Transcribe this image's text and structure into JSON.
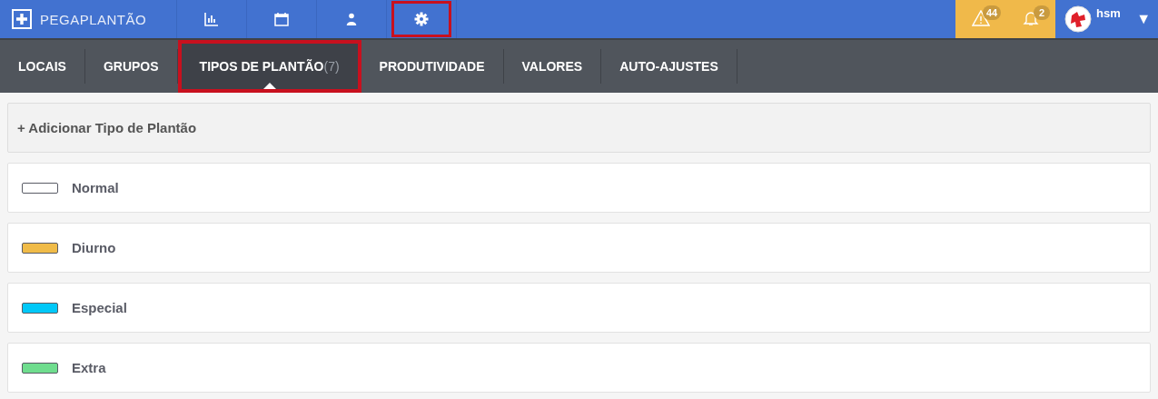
{
  "brand": {
    "name": "PEGAPLANTÃO"
  },
  "nav": [
    {
      "kind": "chart",
      "highlighted": false
    },
    {
      "kind": "calendar",
      "highlighted": false
    },
    {
      "kind": "user",
      "highlighted": false
    },
    {
      "kind": "settings",
      "highlighted": true
    }
  ],
  "alerts": [
    {
      "kind": "warning",
      "count": "44"
    },
    {
      "kind": "bell",
      "count": "2"
    }
  ],
  "user": {
    "name": "hsm",
    "caret": "▼"
  },
  "tabs": [
    {
      "label": "LOCAIS",
      "selected": false,
      "highlighted": false
    },
    {
      "label": "GRUPOS",
      "selected": false,
      "highlighted": false
    },
    {
      "label": "TIPOS DE PLANTÃO",
      "count": "(7)",
      "selected": true,
      "highlighted": true
    },
    {
      "label": "PRODUTIVIDADE",
      "selected": false,
      "highlighted": false
    },
    {
      "label": "VALORES",
      "selected": false,
      "highlighted": false
    },
    {
      "label": "AUTO-AJUSTES",
      "selected": false,
      "highlighted": false
    }
  ],
  "add_button": "+ Adicionar Tipo de Plantão",
  "shift_types": [
    {
      "name": "Normal",
      "color": "#ffffff"
    },
    {
      "name": "Diurno",
      "color": "#f0bb48"
    },
    {
      "name": "Especial",
      "color": "#00c8f8"
    },
    {
      "name": "Extra",
      "color": "#6fdd8e"
    }
  ]
}
